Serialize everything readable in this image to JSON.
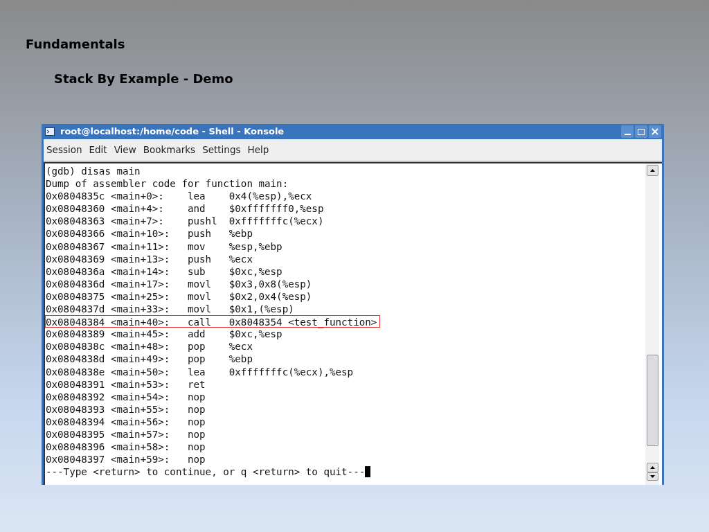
{
  "slide": {
    "title": "Fundamentals",
    "subtitle": "Stack By Example - Demo"
  },
  "window": {
    "title": "root@localhost:/home/code - Shell - Konsole"
  },
  "menu": [
    "Session",
    "Edit",
    "View",
    "Bookmarks",
    "Settings",
    "Help"
  ],
  "terminal": {
    "lines": [
      {
        "text": "(gdb) disas main",
        "highlighted": false
      },
      {
        "text": "Dump of assembler code for function main:",
        "highlighted": false
      },
      {
        "text": "0x0804835c <main+0>:    lea    0x4(%esp),%ecx",
        "highlighted": false
      },
      {
        "text": "0x08048360 <main+4>:    and    $0xfffffff0,%esp",
        "highlighted": false
      },
      {
        "text": "0x08048363 <main+7>:    pushl  0xfffffffc(%ecx)",
        "highlighted": false
      },
      {
        "text": "0x08048366 <main+10>:   push   %ebp",
        "highlighted": false
      },
      {
        "text": "0x08048367 <main+11>:   mov    %esp,%ebp",
        "highlighted": false
      },
      {
        "text": "0x08048369 <main+13>:   push   %ecx",
        "highlighted": false
      },
      {
        "text": "0x0804836a <main+14>:   sub    $0xc,%esp",
        "highlighted": false
      },
      {
        "text": "0x0804836d <main+17>:   movl   $0x3,0x8(%esp)",
        "highlighted": false
      },
      {
        "text": "0x08048375 <main+25>:   movl   $0x2,0x4(%esp)",
        "highlighted": false
      },
      {
        "text": "0x0804837d <main+33>:   movl   $0x1,(%esp)",
        "highlighted": false
      },
      {
        "text": "0x08048384 <main+40>:   call   0x8048354 <test_function>",
        "highlighted": true
      },
      {
        "text": "0x08048389 <main+45>:   add    $0xc,%esp",
        "highlighted": false
      },
      {
        "text": "0x0804838c <main+48>:   pop    %ecx",
        "highlighted": false
      },
      {
        "text": "0x0804838d <main+49>:   pop    %ebp",
        "highlighted": false
      },
      {
        "text": "0x0804838e <main+50>:   lea    0xfffffffc(%ecx),%esp",
        "highlighted": false
      },
      {
        "text": "0x08048391 <main+53>:   ret",
        "highlighted": false
      },
      {
        "text": "0x08048392 <main+54>:   nop",
        "highlighted": false
      },
      {
        "text": "0x08048393 <main+55>:   nop",
        "highlighted": false
      },
      {
        "text": "0x08048394 <main+56>:   nop",
        "highlighted": false
      },
      {
        "text": "0x08048395 <main+57>:   nop",
        "highlighted": false
      },
      {
        "text": "0x08048396 <main+58>:   nop",
        "highlighted": false
      },
      {
        "text": "0x08048397 <main+59>:   nop",
        "highlighted": false
      }
    ],
    "prompt": "---Type <return> to continue, or q <return> to quit---"
  }
}
